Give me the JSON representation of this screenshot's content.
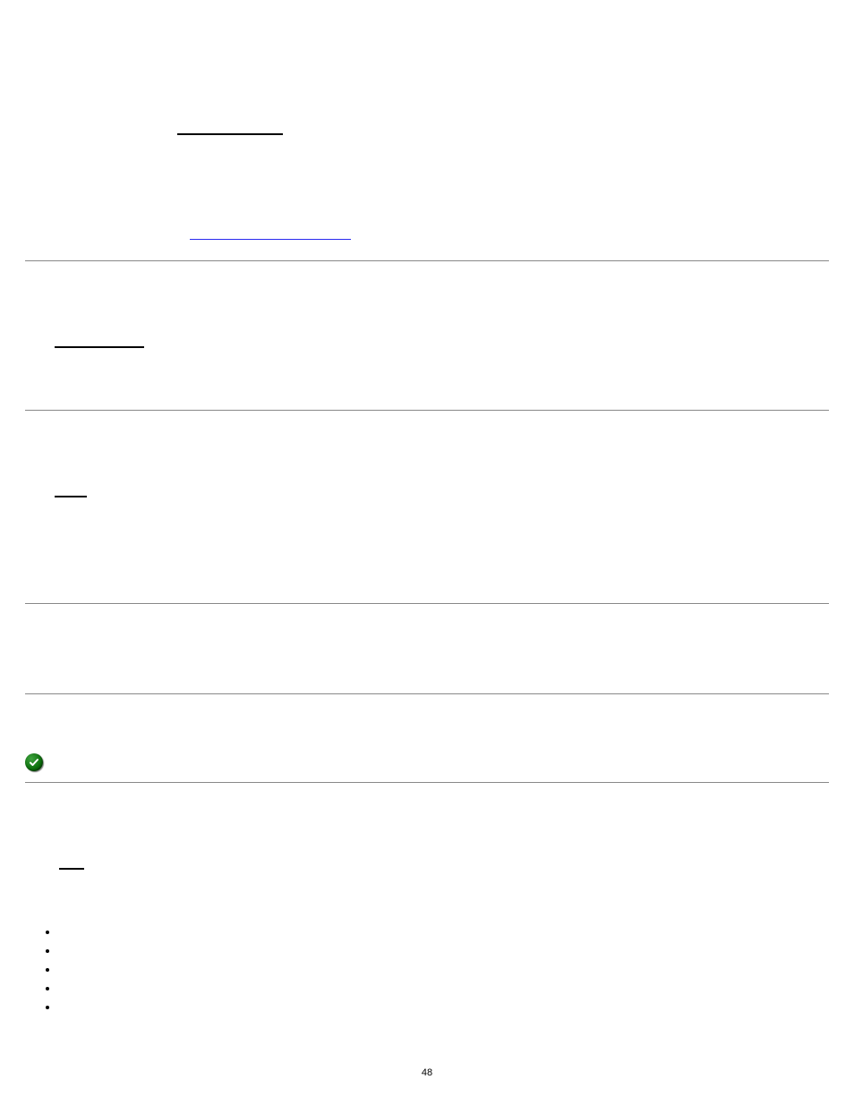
{
  "page_number": "48",
  "lines": {
    "top_black": "",
    "blue_link": "",
    "mid_black": "",
    "short_black": "",
    "lower_black": ""
  },
  "bullets": [
    "",
    "",
    "",
    "",
    ""
  ]
}
